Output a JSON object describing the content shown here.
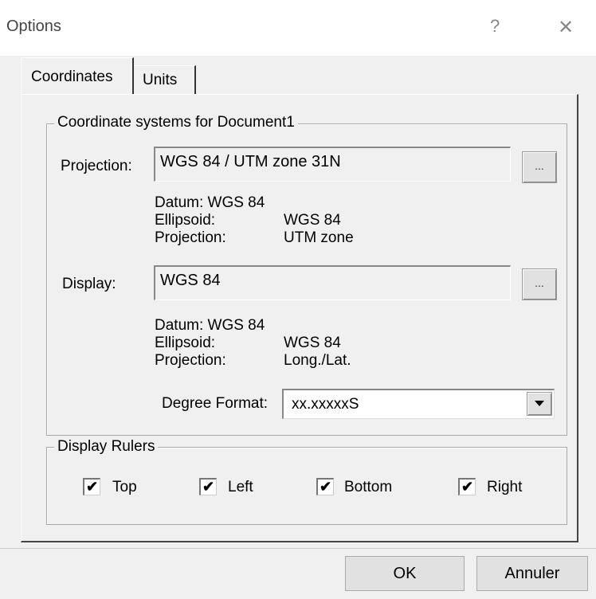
{
  "window": {
    "title": "Options",
    "help_glyph": "?",
    "close_glyph": "✕"
  },
  "tabs": [
    {
      "label": "Coordinates",
      "active": true
    },
    {
      "label": "Units",
      "active": false
    }
  ],
  "coordinate_systems": {
    "legend": "Coordinate systems for Document1",
    "projection": {
      "label": "Projection:",
      "value": "WGS 84 / UTM zone 31N",
      "browse_label": "...",
      "datum_line": "Datum:  WGS 84",
      "ellipsoid_label": "Ellipsoid:",
      "ellipsoid_value": "WGS 84",
      "projection_label": "Projection:",
      "projection_value": "UTM zone"
    },
    "display": {
      "label": "Display:",
      "value": "WGS 84",
      "browse_label": "...",
      "datum_line": "Datum:  WGS 84",
      "ellipsoid_label": "Ellipsoid:",
      "ellipsoid_value": "WGS 84",
      "projection_label": "Projection:",
      "projection_value": "Long./Lat."
    },
    "degree_format": {
      "label": "Degree Format:",
      "value": "xx.xxxxxS"
    }
  },
  "display_rulers": {
    "legend": "Display Rulers",
    "items": [
      {
        "label": "Top",
        "checked": true
      },
      {
        "label": "Left",
        "checked": true
      },
      {
        "label": "Bottom",
        "checked": true
      },
      {
        "label": "Right",
        "checked": true
      }
    ],
    "check_glyph": "✔"
  },
  "buttons": {
    "ok": "OK",
    "cancel": "Annuler"
  }
}
